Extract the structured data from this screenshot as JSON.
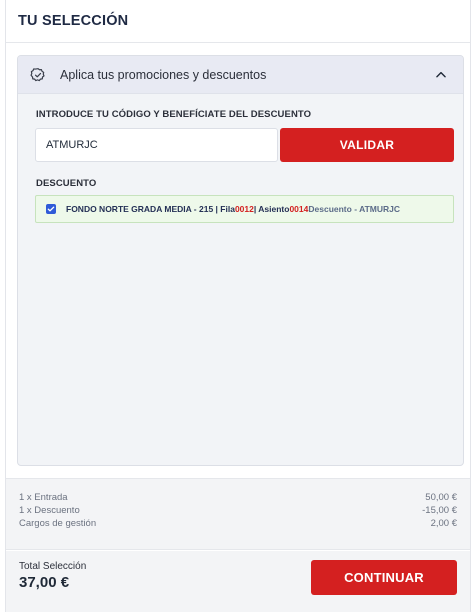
{
  "header": {
    "title": "TU SELECCIÓN"
  },
  "promo": {
    "title": "Aplica tus promociones y descuentos",
    "icon": "badge-check-icon",
    "expanded": true,
    "code_label": "INTRODUCE TU CÓDIGO Y BENEFÍCIATE DEL DESCUENTO",
    "code_value": "ATMURJC",
    "validate_label": "VALIDAR",
    "discount_label": "DESCUENTO",
    "discount_item": {
      "checked": true,
      "prefix": "FONDO NORTE GRADA MEDIA - 215 | Fila ",
      "row": "0012",
      "seat_prefix": " | Asiento ",
      "seat": "0014",
      "suffix": " Descuento - ATMURJC"
    }
  },
  "summary": {
    "rows": [
      {
        "label": "1 x Entrada",
        "amount": "50,00 €"
      },
      {
        "label": "1 x Descuento",
        "amount": "-15,00 €"
      },
      {
        "label": "Cargos de gestión",
        "amount": "2,00 €"
      }
    ]
  },
  "footer": {
    "total_label": "Total Selección",
    "total_value": "37,00 €",
    "continue_label": "CONTINUAR"
  },
  "colors": {
    "accent": "#d42020",
    "checkbox": "#2f5bd8",
    "discount_bg": "#eef9ea",
    "promo_header_bg": "#e8eaf3"
  }
}
